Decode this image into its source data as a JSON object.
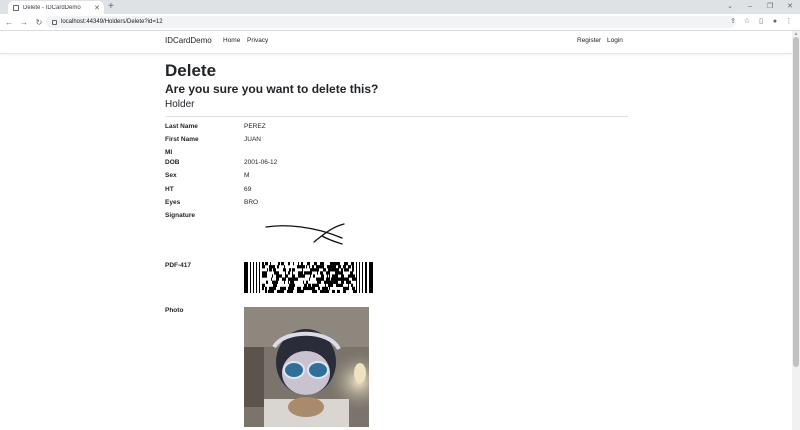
{
  "browser": {
    "tab_title": "Delete - IDCardDemo",
    "url": "localhost:44349/Holders/Delete?id=12",
    "new_tab_icon": "plus-icon",
    "nav_icons": [
      "back-arrow-icon",
      "forward-arrow-icon",
      "reload-icon"
    ],
    "toolbar_icons": [
      "share-icon",
      "star-icon",
      "sidebar-icon",
      "profile-icon",
      "menu-icon"
    ]
  },
  "site_nav": {
    "brand": "IDCardDemo",
    "links": [
      "Home",
      "Privacy"
    ],
    "right_links": [
      "Register",
      "Login"
    ]
  },
  "page": {
    "heading": "Delete",
    "question": "Are you sure you want to delete this?",
    "entity": "Holder"
  },
  "fields": [
    {
      "label": "Last Name",
      "value": "PEREZ"
    },
    {
      "label": "First Name",
      "value": "JUAN"
    },
    {
      "label": "MI",
      "value": ""
    },
    {
      "label": "DOB",
      "value": "2001-06-12"
    },
    {
      "label": "Sex",
      "value": "M"
    },
    {
      "label": "HT",
      "value": "69"
    },
    {
      "label": "Eyes",
      "value": "BRO"
    }
  ],
  "signature_label": "Signature",
  "pdf417_label": "PDF-417",
  "photo_label": "Photo",
  "colors": {
    "link": "#212529",
    "chrome_bg": "#dee1e6",
    "omnibox_bg": "#f1f3f4"
  }
}
